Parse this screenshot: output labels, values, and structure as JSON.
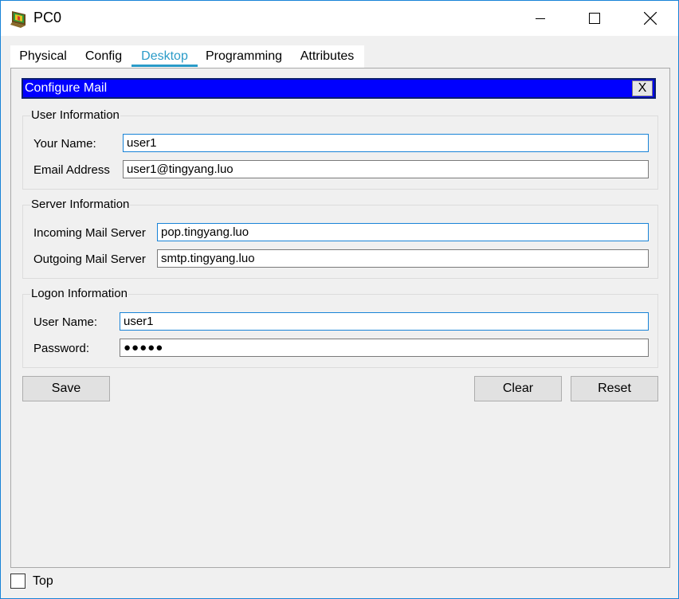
{
  "window": {
    "title": "PC0"
  },
  "tabs": [
    {
      "label": "Physical",
      "active": false
    },
    {
      "label": "Config",
      "active": false
    },
    {
      "label": "Desktop",
      "active": true
    },
    {
      "label": "Programming",
      "active": false
    },
    {
      "label": "Attributes",
      "active": false
    }
  ],
  "panel": {
    "title": "Configure Mail",
    "close_label": "X"
  },
  "user_info": {
    "legend": "User Information",
    "name_label": "Your Name:",
    "name_value": "user1",
    "email_label": "Email Address",
    "email_value": "user1@tingyang.luo"
  },
  "server_info": {
    "legend": "Server Information",
    "incoming_label": "Incoming Mail Server",
    "incoming_value": "pop.tingyang.luo",
    "outgoing_label": "Outgoing Mail Server",
    "outgoing_value": "smtp.tingyang.luo"
  },
  "logon_info": {
    "legend": "Logon Information",
    "username_label": "User Name:",
    "username_value": "user1",
    "password_label": "Password:",
    "password_value": "●●●●●"
  },
  "buttons": {
    "save": "Save",
    "clear": "Clear",
    "reset": "Reset"
  },
  "footer": {
    "top_label": "Top",
    "top_checked": false
  },
  "colors": {
    "accent": "#2a9bc8",
    "panel_header": "#0000ff",
    "window_border": "#1883d7"
  }
}
